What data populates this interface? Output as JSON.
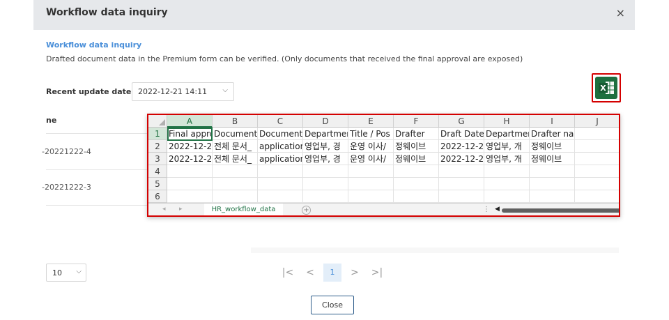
{
  "modal": {
    "title": "Workflow data inquiry",
    "close_icon": "×"
  },
  "section": {
    "title": "Workflow data inquiry",
    "description": "Drafted document data in the Premium form can be verified. (Only documents that received the final approval are exposed)"
  },
  "update": {
    "label": "Recent update date",
    "value": "2022-12-21 14:11"
  },
  "excel_button": {
    "icon": "excel-icon",
    "glyph": "X",
    "color": "#1e6f3f"
  },
  "background_table": {
    "header": "ne",
    "rows": [
      "-20221222-4",
      "-20221222-3"
    ]
  },
  "spreadsheet": {
    "columns": [
      "A",
      "B",
      "C",
      "D",
      "E",
      "F",
      "G",
      "H",
      "I",
      "J"
    ],
    "rows": [
      [
        "Final appro",
        "Document",
        "Document",
        "Departmer",
        "Title / Pos",
        "Drafter",
        "Draft Date",
        "Departmer",
        "Drafter name",
        ""
      ],
      [
        "2022-12-2",
        "전체 문서_",
        "application",
        "영업부, 경",
        "운영 이사/",
        "정웨이브",
        "2022-12-2",
        "영업부, 개",
        "정웨이브",
        ""
      ],
      [
        "2022-12-2",
        "전체 문서_",
        "application",
        "영업부, 경",
        "운영 이사/",
        "정웨이브",
        "2022-12-2",
        "영업부, 개",
        "정웨이브",
        ""
      ],
      [
        "",
        "",
        "",
        "",
        "",
        "",
        "",
        "",
        "",
        ""
      ],
      [
        "",
        "",
        "",
        "",
        "",
        "",
        "",
        "",
        "",
        ""
      ],
      [
        "",
        "",
        "",
        "",
        "",
        "",
        "",
        "",
        "",
        ""
      ]
    ],
    "row_numbers": [
      "1",
      "2",
      "3",
      "4",
      "5",
      "6"
    ],
    "sheet_tab": "HR_workflow_data",
    "accent": "#217346"
  },
  "pagination": {
    "page_size": "10",
    "first": "|<",
    "prev": "<",
    "current": "1",
    "next": ">",
    "last": ">|"
  },
  "footer": {
    "close_label": "Close"
  }
}
